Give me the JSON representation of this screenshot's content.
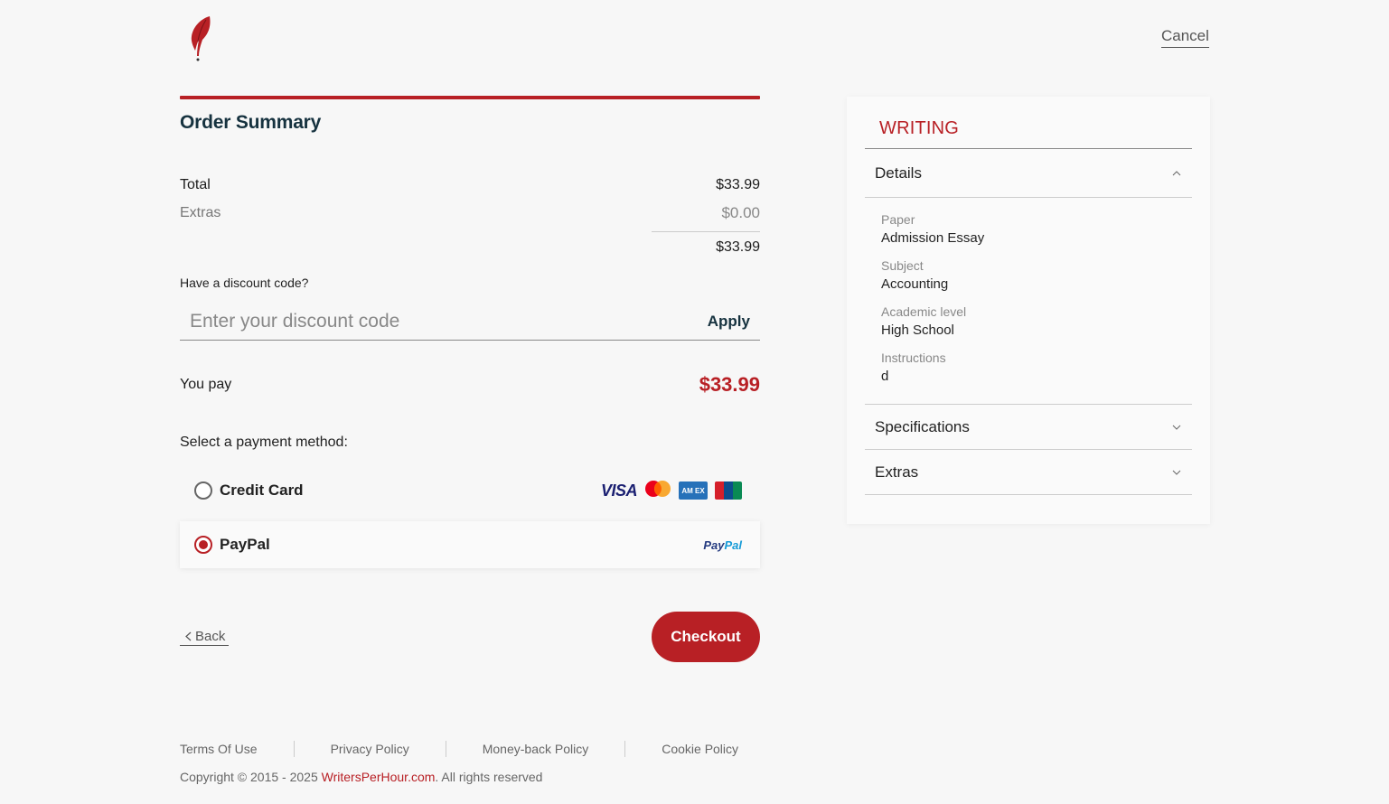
{
  "header": {
    "cancel_label": "Cancel"
  },
  "summary": {
    "title": "Order Summary",
    "total_label": "Total",
    "total_value": "$33.99",
    "extras_label": "Extras",
    "extras_value": "$0.00",
    "subtotal_value": "$33.99",
    "discount_label": "Have a discount code?",
    "discount_placeholder": "Enter your discount code",
    "discount_value": "",
    "apply_label": "Apply",
    "you_pay_label": "You pay",
    "you_pay_value": "$33.99",
    "payment_method_label": "Select a payment method:",
    "methods": [
      {
        "label": "Credit Card",
        "selected": false,
        "icons": [
          "visa-icon",
          "mastercard-icon",
          "amex-icon",
          "unionpay-icon"
        ]
      },
      {
        "label": "PayPal",
        "selected": true,
        "icons": [
          "paypal-icon"
        ]
      }
    ],
    "visa_text": "VISA",
    "amex_text": "AM EX",
    "paypal_text_1": "Pay",
    "paypal_text_2": "Pal",
    "back_label": "Back",
    "checkout_label": "Checkout"
  },
  "panel": {
    "title": "WRITING",
    "details_label": "Details",
    "details": [
      {
        "label": "Paper",
        "value": "Admission Essay"
      },
      {
        "label": "Subject",
        "value": "Accounting"
      },
      {
        "label": "Academic level",
        "value": "High School"
      },
      {
        "label": "Instructions",
        "value": "d"
      }
    ],
    "specifications_label": "Specifications",
    "extras_label": "Extras"
  },
  "footer": {
    "links": [
      "Terms Of Use",
      "Privacy Policy",
      "Money-back Policy",
      "Cookie Policy"
    ],
    "copyright_prefix": "Copyright © 2015 - 2025 ",
    "copyright_link": "WritersPerHour.com",
    "copyright_suffix": ". All rights reserved"
  },
  "colors": {
    "accent": "#b82025",
    "heading": "#16323f",
    "background": "#f7f7f7"
  }
}
